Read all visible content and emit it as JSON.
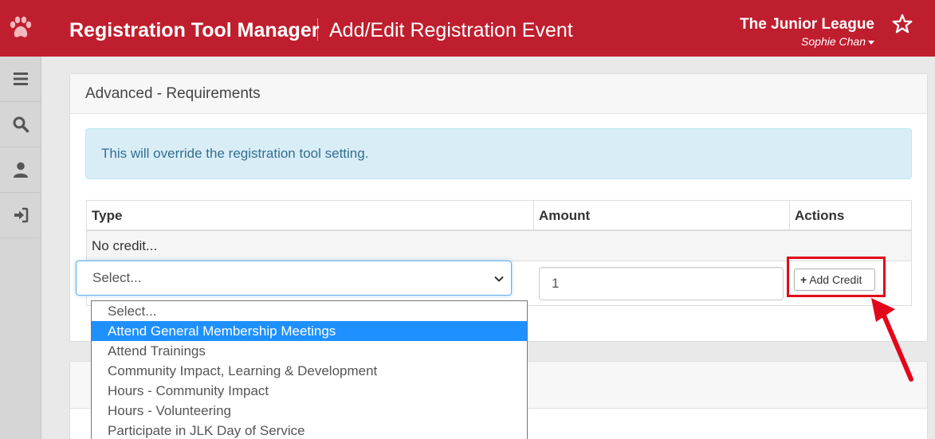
{
  "header": {
    "app_title": "Registration Tool Manager",
    "page_title": "Add/Edit Registration Event",
    "org_name": "The Junior League",
    "user_name": "Sophie Chan",
    "brand_color": "#bf1e2e"
  },
  "sidebar": {
    "items": [
      {
        "icon": "menu-icon"
      },
      {
        "icon": "search-icon"
      },
      {
        "icon": "user-icon"
      },
      {
        "icon": "sign-in-icon"
      }
    ]
  },
  "requirements_panel": {
    "title": "Advanced - Requirements",
    "info_message": "This will override the registration tool setting.",
    "table": {
      "columns": [
        "Type",
        "Amount",
        "Actions"
      ],
      "empty_message": "No credit..."
    },
    "type_select": {
      "value": "Select...",
      "options": [
        "Select...",
        "Attend General Membership Meetings",
        "Attend Trainings",
        "Community Impact, Learning & Development",
        "Hours - Community Impact",
        "Hours - Volunteering",
        "Participate in JLK Day of Service"
      ],
      "highlighted_option": "Attend General Membership Meetings"
    },
    "amount_value": "1",
    "add_button_label": "Add Credit"
  },
  "annotation": {
    "color": "#e3071b"
  }
}
